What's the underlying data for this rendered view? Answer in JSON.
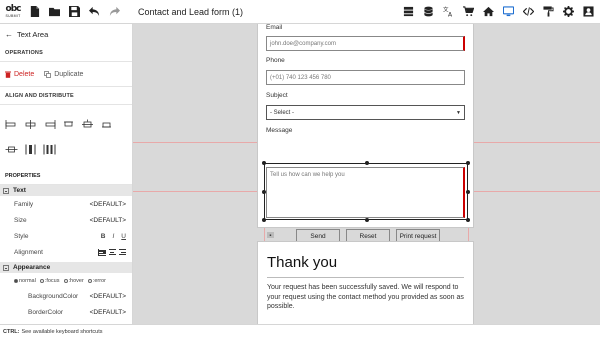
{
  "app": {
    "logo_mark": "obc",
    "logo_sub": "SUBMIT",
    "document_title": "Contact and Lead form (1)"
  },
  "toolbar": {
    "left_icons": [
      "file-icon",
      "folder-icon",
      "save-icon",
      "undo-icon",
      "redo-icon"
    ],
    "right_icons": [
      "layers-icon",
      "database-icon",
      "translate-icon",
      "cart-icon",
      "home-icon",
      "monitor-icon",
      "code-icon",
      "paint-roller-icon",
      "gear-icon",
      "user-icon"
    ]
  },
  "panel": {
    "back_label": "Text Area",
    "operations_heading": "OPERATIONS",
    "delete_label": "Delete",
    "duplicate_label": "Duplicate",
    "align_heading": "ALIGN AND DISTRIBUTE",
    "properties_heading": "PROPERTIES",
    "text_group": {
      "title": "Text",
      "family_label": "Family",
      "family_value": "<DEFAULT>",
      "size_label": "Size",
      "size_value": "<DEFAULT>",
      "style_label": "Style",
      "style_bold": "B",
      "style_italic": "I",
      "style_underline": "U",
      "alignment_label": "Alignment"
    },
    "appearance_group": {
      "title": "Appearance",
      "states": [
        "normal",
        ":focus",
        ":hover",
        ":error"
      ],
      "background_label": "BackgroundColor",
      "background_value": "<DEFAULT>",
      "border_label": "BorderColor",
      "border_value": "<DEFAULT>"
    }
  },
  "form": {
    "email_label": "Email",
    "email_placeholder": "john.doe@company.com",
    "phone_label": "Phone",
    "phone_placeholder": "(+01) 740 123 456 780",
    "subject_label": "Subject",
    "subject_value": "- Select -",
    "message_label": "Message",
    "message_placeholder": "Tell us how can we help you",
    "send_label": "Send",
    "reset_label": "Reset",
    "print_label": "Print request"
  },
  "thanks": {
    "title": "Thank you",
    "body": "Your request has been successfully saved. We will respond to your request using the contact method you provided as soon as possible."
  },
  "status": {
    "key": "CTRL:",
    "text": "See available keyboard shortcuts"
  },
  "colors": {
    "accent_red": "#cc2222",
    "guide_line": "#e8a9a9",
    "canvas_bg": "#d9d9d9",
    "active_device_blue": "#1f6fd1"
  }
}
